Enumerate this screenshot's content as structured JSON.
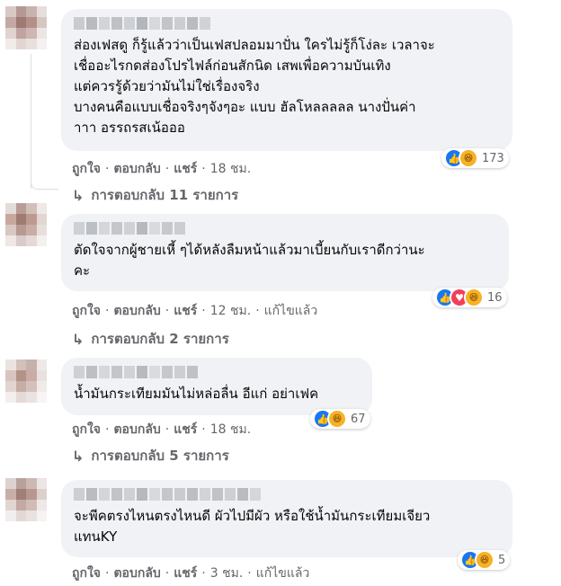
{
  "actions": {
    "like": "ถูกใจ",
    "reply": "ตอบกลับ",
    "share": "แชร์",
    "edited": "แก้ไขแล้ว",
    "separator": "·"
  },
  "reply_arrow": "↳",
  "comments": [
    {
      "text": "ส่องเฟสดู ก็รู้แล้วว่าเป็นเฟสปลอมมาปั่น ใครไม่รู้ก็โง่ละ เวลาจะ\nเชื่ออะไรกดส่องโปรไฟล์ก่อนสักนิด เสพเพื่อความบันเทิง\nแต่ควรรู้ด้วยว่ามันไม่ใช่เรื่องจริง\nบางคนคือแบบเชื่อจริงๆจังๆอะ แบบ ฮัลโหลลลลล นางปั่นค่า\nาาา อรรถรสเน้อออ",
      "time": "18 ชม.",
      "reactions": [
        "like-icon",
        "haha-icon"
      ],
      "reaction_count": "173",
      "replies_label": "การตอบกลับ 11 รายการ"
    },
    {
      "text": "ตัดใจจากผู้ชายเหี้ ๆได้หลังลืมหน้าแล้วมาเบี้ยนกับเราดีกว่านะ\nคะ",
      "time": "12 ชม.",
      "edited": true,
      "reactions": [
        "like-icon",
        "love-icon",
        "haha-icon"
      ],
      "reaction_count": "16",
      "replies_label": "การตอบกลับ 2 รายการ"
    },
    {
      "text": "น้ำมันกระเทียมมันไม่หล่อลื่น อีแก่ อย่าเฟค",
      "time": "18 ชม.",
      "reactions": [
        "like-icon",
        "haha-icon"
      ],
      "reaction_count": "67",
      "replies_label": "การตอบกลับ 5 รายการ"
    },
    {
      "text": "จะพีคตรงไหนตรงไหนดี ผัวไปมีผัว หรือใช้น้ำมันกระเทียมเจียว\nแทนKY",
      "time": "3 ชม.",
      "edited": true,
      "reactions": [
        "like-icon",
        "haha-icon"
      ],
      "reaction_count": "5"
    }
  ]
}
